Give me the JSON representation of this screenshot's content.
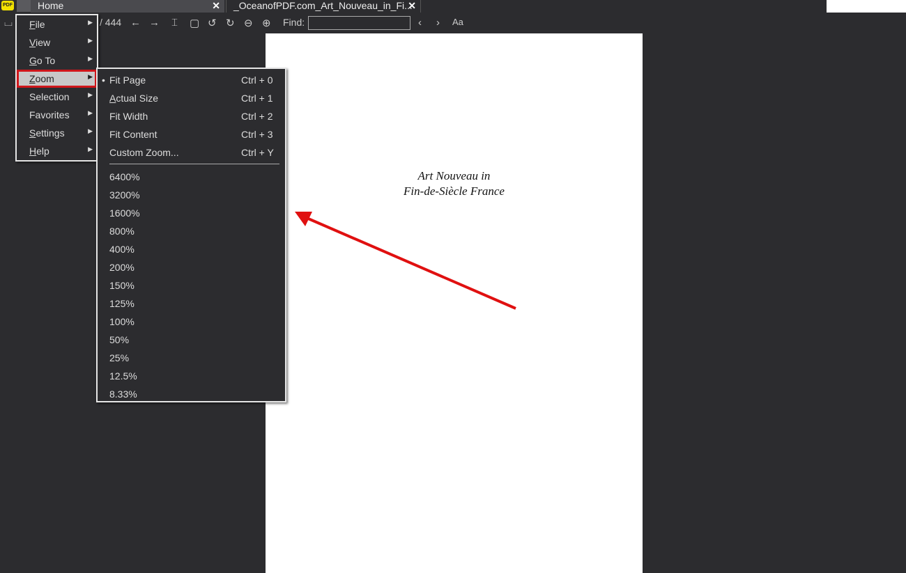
{
  "tabs": [
    {
      "label": "Home"
    },
    {
      "label": "_OceanofPDF.com_Art_Nouveau_in_Fi..."
    }
  ],
  "app_logo": "PDF",
  "toolbar": {
    "page_total": "/ 444",
    "find_label": "Find:",
    "find_value": ""
  },
  "document": {
    "title_line1": "Art Nouveau in",
    "title_line2": "Fin-de-Siècle France"
  },
  "main_menu": [
    {
      "label": "File",
      "accel": 0
    },
    {
      "label": "View",
      "accel": 0
    },
    {
      "label": "Go To",
      "accel": 0
    },
    {
      "label": "Zoom",
      "accel": 0,
      "selected": true
    },
    {
      "label": "Selection",
      "accel": 1
    },
    {
      "label": "Favorites",
      "accel": 1
    },
    {
      "label": "Settings",
      "accel": 0
    },
    {
      "label": "Help",
      "accel": 0
    }
  ],
  "zoom_menu": {
    "commands": [
      {
        "label": "Fit Page",
        "accel": 4,
        "shortcut": "Ctrl + 0",
        "checked": true
      },
      {
        "label": "Actual Size",
        "accel": 0,
        "shortcut": "Ctrl + 1"
      },
      {
        "label": "Fit Width",
        "accel": 4,
        "shortcut": "Ctrl + 2"
      },
      {
        "label": "Fit Content",
        "accel": 4,
        "shortcut": "Ctrl + 3"
      },
      {
        "label": "Custom Zoom...",
        "accel": 7,
        "shortcut": "Ctrl + Y"
      }
    ],
    "levels": [
      "6400%",
      "3200%",
      "1600%",
      "800%",
      "400%",
      "200%",
      "150%",
      "125%",
      "100%",
      "50%",
      "25%",
      "12.5%",
      "8.33%"
    ]
  },
  "colors": {
    "highlight": "#d0161b",
    "arrow": "#e01010",
    "background": "#2c2c2f"
  }
}
